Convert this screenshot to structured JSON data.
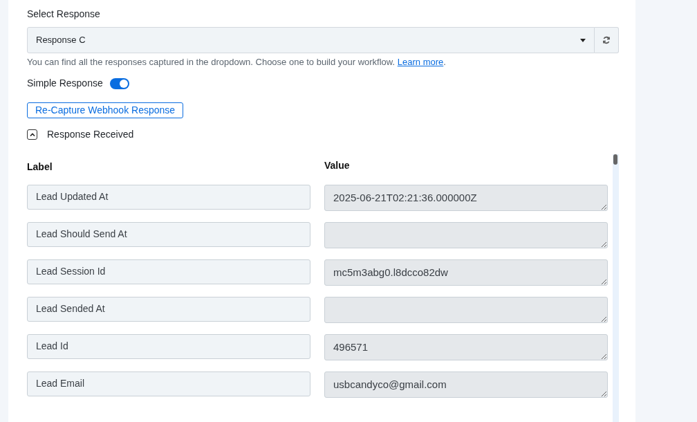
{
  "select_response": {
    "label": "Select Response",
    "value": "Response C"
  },
  "help": {
    "text": "You can find all the responses captured in the dropdown. Choose one to build your workflow.",
    "link": "Learn more",
    "suffix": "."
  },
  "simple_response": {
    "label": "Simple Response",
    "on": true
  },
  "recapture_button": "Re-Capture Webhook Response",
  "response_received": {
    "label": "Response Received",
    "expanded": true
  },
  "table": {
    "columns": [
      "Label",
      "Value"
    ],
    "rows": [
      {
        "label": "Lead Updated At",
        "value": "2025-06-21T02:21:36.000000Z"
      },
      {
        "label": "Lead Should Send At",
        "value": ""
      },
      {
        "label": "Lead Session Id",
        "value": "mc5m3abg0.l8dcco82dw"
      },
      {
        "label": "Lead Sended At",
        "value": ""
      },
      {
        "label": "Lead Id",
        "value": "496571"
      },
      {
        "label": "Lead Email",
        "value": "usbcandyco@gmail.com"
      }
    ]
  }
}
